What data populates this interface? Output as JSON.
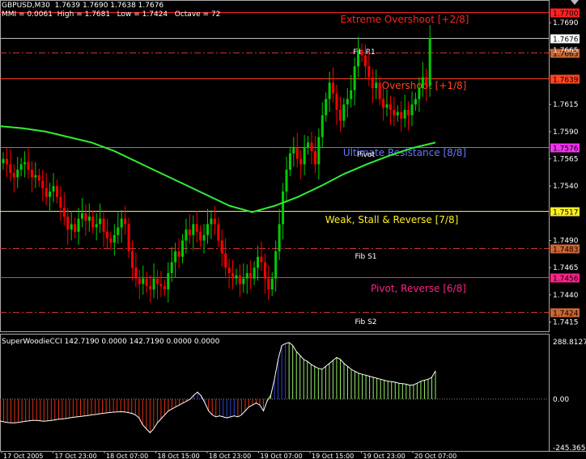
{
  "header": {
    "line1": "GBPUSD,M30  1.7639 1.7690 1.7638 1.7676",
    "line2": "MMI = 0.0061  High = 1.7681   Low = 1.7424   Octave = 72"
  },
  "indicator_title": "SuperWoodieCCI 142.7190 0.0000 142.7190 0.0000 0.0000",
  "colors": {
    "background": "#000000",
    "bull": "#00cc00",
    "bear": "#ff0000",
    "ma": "#33ee33",
    "cci_pos": "#99ee66",
    "cci_neg": "#dd3311",
    "cci_blue": "#3344cc",
    "axis_text": "#ffffff"
  },
  "levels": [
    {
      "label": "Extreme Overshoot [+2/8]",
      "price": 1.77,
      "tag": "1.7700",
      "color": "#ff2222",
      "tag_bg": "#ff2222",
      "style": "solid"
    },
    {
      "label": "Fib R1",
      "price": 1.7663,
      "tag": "1.7663",
      "color": "#cc3333",
      "tag_bg": "#cc6633",
      "style": "dashdot"
    },
    {
      "label": "Overshoot [+1/8]",
      "price": 1.7639,
      "tag": "1.7639",
      "color": "#ff4422",
      "tag_bg": "#ff4422",
      "style": "solid"
    },
    {
      "label": "Ultimate Resistance [8/8]",
      "price": 1.7576,
      "tag": "1.7576",
      "color": "#6677ff",
      "tag_bg": "#ee33ee",
      "style": "solid"
    },
    {
      "label": "Pivot",
      "price": 1.7576,
      "tag": "",
      "color": "#dd44dd",
      "tag_bg": "",
      "style": "dash"
    },
    {
      "label": "Weak, Stall & Reverse [7/8]",
      "price": 1.7517,
      "tag": "1.7517",
      "color": "#ffee22",
      "tag_bg": "#ffee22",
      "style": "solid"
    },
    {
      "label": "Fib S1",
      "price": 1.7483,
      "tag": "1.7483",
      "color": "#cc3333",
      "tag_bg": "#cc6633",
      "style": "dashdot"
    },
    {
      "label": "Pivot, Reverse [6/8]",
      "price": 1.7456,
      "tag": "1.7456",
      "color": "#ff2288",
      "tag_bg": "#ff2288",
      "style": "solid"
    },
    {
      "label": "Fib S2",
      "price": 1.7424,
      "tag": "1.7424",
      "color": "#cc3333",
      "tag_bg": "#cc6633",
      "style": "dashdot"
    }
  ],
  "price_axis": {
    "ticks": [
      "1.7690",
      "1.7665",
      "1.7615",
      "1.7590",
      "1.7565",
      "1.7540",
      "1.7490",
      "1.7465",
      "1.7440",
      "1.7415"
    ],
    "current_tag": "1.7676",
    "current_price": 1.7676
  },
  "cci_axis": {
    "ticks": [
      "288.8127",
      "0.00",
      "-245.3651"
    ]
  },
  "time_axis": {
    "labels": [
      "17 Oct 2005",
      "17 Oct 23:00",
      "18 Oct 07:00",
      "18 Oct 15:00",
      "18 Oct 23:00",
      "19 Oct 07:00",
      "19 Oct 15:00",
      "19 Oct 23:00",
      "20 Oct 07:00"
    ]
  },
  "chart_data": {
    "type": "candlestick",
    "symbol": "GBPUSD,M30",
    "ylim": [
      1.7408,
      1.7705
    ],
    "bars": [
      1.7565,
      1.756,
      1.7552,
      1.7548,
      1.7555,
      1.756,
      1.7562,
      1.7555,
      1.7548,
      1.755,
      1.7545,
      1.7538,
      1.753,
      1.7535,
      1.754,
      1.753,
      1.752,
      1.7512,
      1.75,
      1.7505,
      1.7498,
      1.751,
      1.7515,
      1.7508,
      1.7512,
      1.7502,
      1.7505,
      1.751,
      1.7498,
      1.7492,
      1.7488,
      1.7495,
      1.7502,
      1.751,
      1.7505,
      1.748,
      1.7465,
      1.7455,
      1.745,
      1.7455,
      1.7448,
      1.7445,
      1.7455,
      1.745,
      1.7448,
      1.7445,
      1.746,
      1.747,
      1.748,
      1.7475,
      1.749,
      1.75,
      1.7495,
      1.7505,
      1.7498,
      1.749,
      1.7495,
      1.7505,
      1.751,
      1.7505,
      1.749,
      1.7478,
      1.7465,
      1.746,
      1.7455,
      1.7458,
      1.745,
      1.7455,
      1.746,
      1.7455,
      1.7465,
      1.7475,
      1.747,
      1.7455,
      1.7445,
      1.7455,
      1.748,
      1.7505,
      1.7535,
      1.7555,
      1.757,
      1.7575,
      1.7565,
      1.756,
      1.7575,
      1.758,
      1.7572,
      1.756,
      1.7585,
      1.7605,
      1.762,
      1.7635,
      1.7625,
      1.761,
      1.76,
      1.7615,
      1.762,
      1.7628,
      1.765,
      1.7665,
      1.766,
      1.765,
      1.764,
      1.763,
      1.7635,
      1.762,
      1.7612,
      1.7615,
      1.761,
      1.7605,
      1.7608,
      1.7602,
      1.761,
      1.7605,
      1.7615,
      1.762,
      1.763,
      1.764,
      1.7632,
      1.7676
    ],
    "ma": [
      1.7595,
      1.7593,
      1.759,
      1.7585,
      1.758,
      1.7572,
      1.7562,
      1.7552,
      1.7542,
      1.7532,
      1.7522,
      1.7516,
      1.7522,
      1.753,
      1.754,
      1.7551,
      1.756,
      1.7568,
      1.7575,
      1.758
    ],
    "cci": [
      -110,
      -115,
      -118,
      -120,
      -120,
      -118,
      -115,
      -112,
      -110,
      -108,
      -108,
      -110,
      -112,
      -110,
      -108,
      -105,
      -102,
      -100,
      -98,
      -95,
      -92,
      -90,
      -88,
      -85,
      -83,
      -80,
      -78,
      -75,
      -72,
      -70,
      -68,
      -66,
      -65,
      -64,
      -65,
      -68,
      -72,
      -80,
      -95,
      -130,
      -150,
      -170,
      -150,
      -120,
      -100,
      -80,
      -60,
      -50,
      -40,
      -30,
      -20,
      -10,
      0,
      20,
      35,
      15,
      -20,
      -60,
      -80,
      -90,
      -85,
      -90,
      -95,
      -90,
      -85,
      -90,
      -80,
      -60,
      -40,
      -30,
      -20,
      -30,
      -60,
      -10,
      20,
      100,
      200,
      270,
      280,
      285,
      270,
      240,
      220,
      200,
      190,
      175,
      165,
      155,
      150,
      165,
      180,
      195,
      210,
      200,
      180,
      165,
      150,
      140,
      130,
      125,
      120,
      115,
      110,
      105,
      100,
      95,
      90,
      88,
      85,
      80,
      78,
      75,
      70,
      72,
      80,
      90,
      95,
      100,
      110,
      142
    ]
  }
}
